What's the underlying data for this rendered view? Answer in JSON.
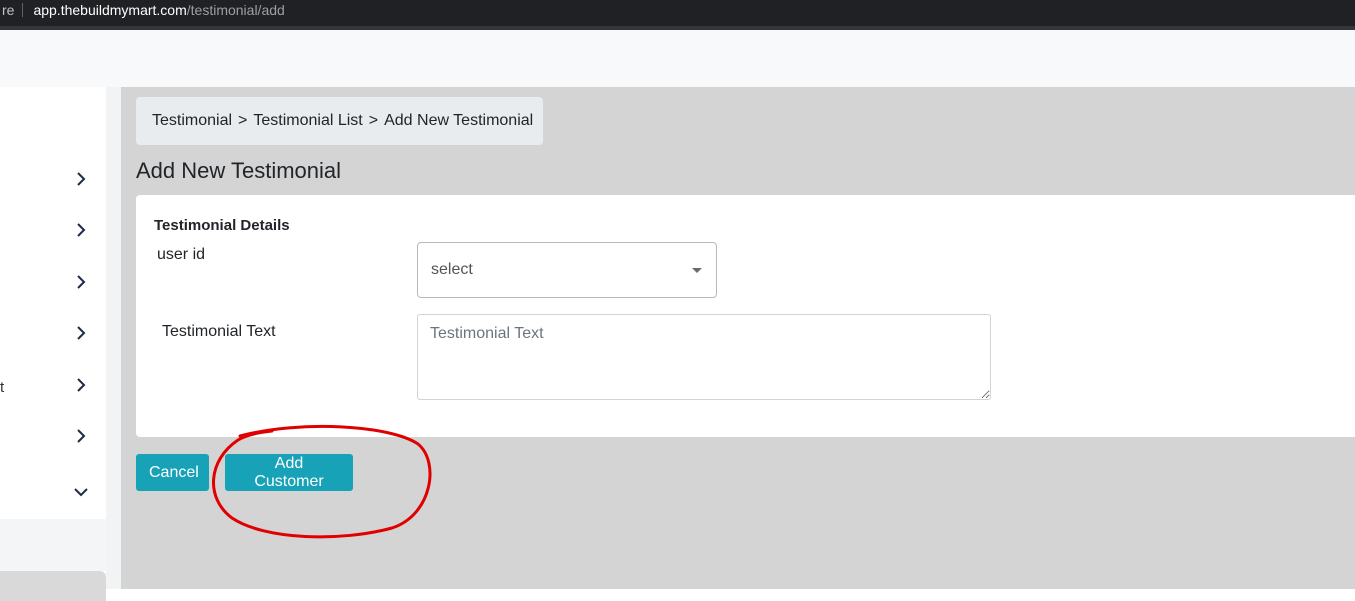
{
  "browser": {
    "left_fragment": "re",
    "url_domain": "app.thebuildmymart.com",
    "url_path": "/testimonial/add"
  },
  "sidebar": {
    "text_fragment": "t",
    "chevrons": [
      "chevron-right-icon",
      "chevron-right-icon",
      "chevron-right-icon",
      "chevron-right-icon",
      "chevron-right-icon",
      "chevron-right-icon",
      "chevron-down-icon"
    ]
  },
  "breadcrumb": {
    "items": [
      "Testimonial",
      "Testimonial List",
      "Add New Testimonial"
    ],
    "separator": ">"
  },
  "page": {
    "title": "Add New Testimonial"
  },
  "form": {
    "section_title": "Testimonial Details",
    "user_id_label": "user id",
    "user_id_value": "select",
    "testimonial_label": "Testimonial Text",
    "testimonial_placeholder": "Testimonial Text"
  },
  "actions": {
    "cancel_label": "Cancel",
    "submit_label": "Add Customer"
  },
  "colors": {
    "primary": "#17a2b8",
    "annotation": "#e00000"
  }
}
